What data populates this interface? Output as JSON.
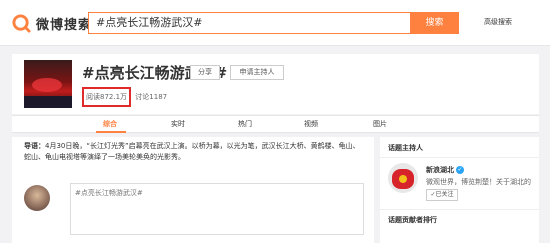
{
  "header": {
    "logo_text": "微博搜索",
    "search_value": "#点亮长江畅游武汉#",
    "search_button": "搜索",
    "advanced_search": "高级搜索"
  },
  "topic": {
    "title": "#点亮长江畅游武汉#",
    "share_label": "分享",
    "apply_host_label": "申请主持人",
    "reads": "阅读872.1万",
    "discussions": "讨论1187"
  },
  "tabs": [
    "综合",
    "实时",
    "热门",
    "视频",
    "图片"
  ],
  "active_tab": "综合",
  "main": {
    "guide_label": "导语：",
    "guide_text": "4月30日晚，“长江灯光秀”启幕亮在武汉上演。以桥为幕，以光为笔，武汉长江大桥、黄鹤楼、龟山、蛇山、龟山电视塔等演绎了一场美轮美奂的光影秀。",
    "post_placeholder": "#点亮长江畅游武汉#"
  },
  "sidebar": {
    "host_title": "话题主持人",
    "host_name": "新浪湖北",
    "host_desc": "微观世界，博览荆楚！关于湖北的",
    "follow_label": "已关注",
    "contributors_title": "话题贡献者排行"
  },
  "colors": {
    "accent": "#ff8140",
    "highlight_box": "#e02b2b",
    "verified": "#2aa4f4"
  }
}
